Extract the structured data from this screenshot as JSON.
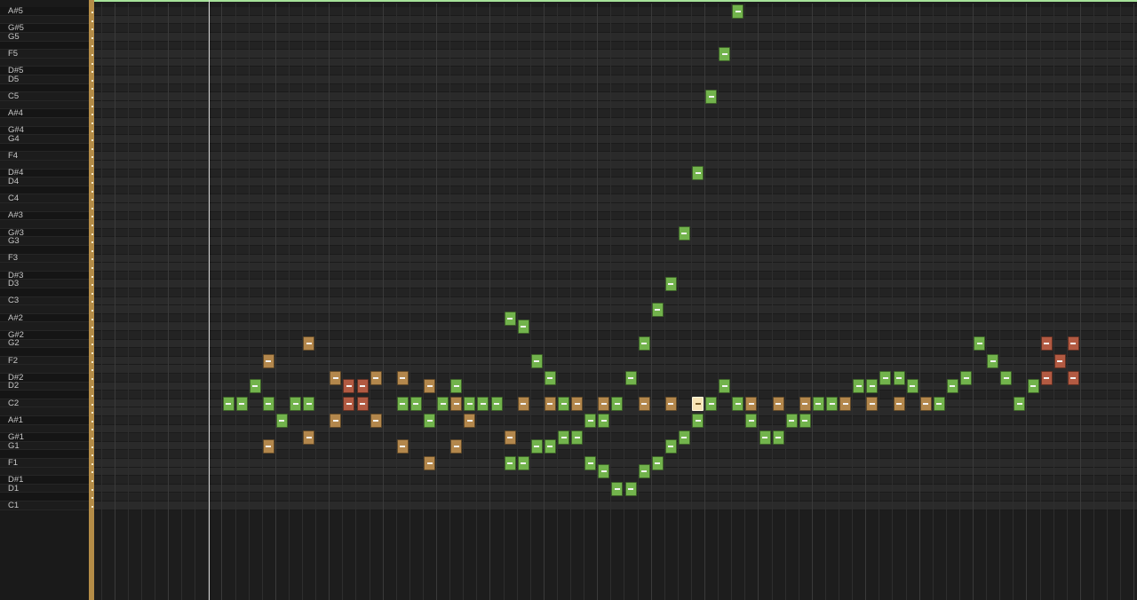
{
  "editor": "piano-roll",
  "colors": {
    "background": "#1d1d1d",
    "white_lane": "#2a2a2a",
    "black_lane": "#232323",
    "note_green": "#72b34c",
    "note_orange": "#b3874c",
    "note_red": "#b25a42",
    "note_selected": "#f7e4b5",
    "loop_strip": "#b48c47",
    "top_marker": "#a6e39a",
    "playhead": "#d8d8d8"
  },
  "keyboard": {
    "pitches": [
      "A#5",
      "A5",
      "G#5",
      "G5",
      "F#5",
      "F5",
      "E5",
      "D#5",
      "D5",
      "C#5",
      "C5",
      "B4",
      "A#4",
      "A4",
      "G#4",
      "G4",
      "F#4",
      "F4",
      "E4",
      "D#4",
      "D4",
      "C#4",
      "C4",
      "B3",
      "A#3",
      "A3",
      "G#3",
      "G3",
      "F#3",
      "F3",
      "E3",
      "D#3",
      "D3",
      "C#3",
      "C3",
      "B2",
      "A#2",
      "A2",
      "G#2",
      "G2",
      "F#2",
      "F2",
      "E2",
      "D#2",
      "D2",
      "C#2",
      "C2",
      "B1",
      "A#1",
      "A1",
      "G#1",
      "G1",
      "F#1",
      "F1",
      "E1",
      "D#1",
      "D1",
      "C#1",
      "C1"
    ],
    "labels": [
      {
        "pitch": "A#5",
        "text": "A#5"
      },
      {
        "pitch": "G#5",
        "text": "G#5"
      },
      {
        "pitch": "G5",
        "text": "G5"
      },
      {
        "pitch": "F5",
        "text": "F5"
      },
      {
        "pitch": "D#5",
        "text": "D#5"
      },
      {
        "pitch": "D5",
        "text": "D5"
      },
      {
        "pitch": "C5",
        "text": "C5"
      },
      {
        "pitch": "A#4",
        "text": "A#4"
      },
      {
        "pitch": "G#4",
        "text": "G#4"
      },
      {
        "pitch": "G4",
        "text": "G4"
      },
      {
        "pitch": "F4",
        "text": "F4"
      },
      {
        "pitch": "D#4",
        "text": "D#4"
      },
      {
        "pitch": "D4",
        "text": "D4"
      },
      {
        "pitch": "C4",
        "text": "C4"
      },
      {
        "pitch": "A#3",
        "text": "A#3"
      },
      {
        "pitch": "G#3",
        "text": "G#3"
      },
      {
        "pitch": "G3",
        "text": "G3"
      },
      {
        "pitch": "F3",
        "text": "F3"
      },
      {
        "pitch": "D#3",
        "text": "D#3"
      },
      {
        "pitch": "D3",
        "text": "D3"
      },
      {
        "pitch": "C3",
        "text": "C3"
      },
      {
        "pitch": "A#2",
        "text": "A#2"
      },
      {
        "pitch": "G#2",
        "text": "G#2"
      },
      {
        "pitch": "G2",
        "text": "G2"
      },
      {
        "pitch": "F2",
        "text": "F2"
      },
      {
        "pitch": "D#2",
        "text": "D#2"
      },
      {
        "pitch": "D2",
        "text": "D2"
      },
      {
        "pitch": "C2",
        "text": "C2"
      },
      {
        "pitch": "A#1",
        "text": "A#1"
      },
      {
        "pitch": "G#1",
        "text": "G#1"
      },
      {
        "pitch": "G1",
        "text": "G1"
      },
      {
        "pitch": "F1",
        "text": "F1"
      },
      {
        "pitch": "D#1",
        "text": "D#1"
      },
      {
        "pitch": "D1",
        "text": "D1"
      },
      {
        "pitch": "C1",
        "text": "C1"
      }
    ]
  },
  "notes": [
    {
      "step": 0,
      "pitch": "C2",
      "color": "green"
    },
    {
      "step": 1,
      "pitch": "C2",
      "color": "green"
    },
    {
      "step": 2,
      "pitch": "D2",
      "color": "green"
    },
    {
      "step": 3,
      "pitch": "F2",
      "color": "orange"
    },
    {
      "step": 3,
      "pitch": "C2",
      "color": "green"
    },
    {
      "step": 3,
      "pitch": "G1",
      "color": "orange"
    },
    {
      "step": 4,
      "pitch": "A#1",
      "color": "green"
    },
    {
      "step": 5,
      "pitch": "C2",
      "color": "green"
    },
    {
      "step": 6,
      "pitch": "G2",
      "color": "orange"
    },
    {
      "step": 6,
      "pitch": "C2",
      "color": "green"
    },
    {
      "step": 6,
      "pitch": "G#1",
      "color": "orange"
    },
    {
      "step": 8,
      "pitch": "D#2",
      "color": "orange"
    },
    {
      "step": 8,
      "pitch": "A#1",
      "color": "orange"
    },
    {
      "step": 9,
      "pitch": "D2",
      "color": "red"
    },
    {
      "step": 9,
      "pitch": "C2",
      "color": "red"
    },
    {
      "step": 10,
      "pitch": "D2",
      "color": "red"
    },
    {
      "step": 10,
      "pitch": "C2",
      "color": "red"
    },
    {
      "step": 11,
      "pitch": "D#2",
      "color": "orange"
    },
    {
      "step": 11,
      "pitch": "A#1",
      "color": "orange"
    },
    {
      "step": 13,
      "pitch": "D#2",
      "color": "orange"
    },
    {
      "step": 13,
      "pitch": "C2",
      "color": "green"
    },
    {
      "step": 13,
      "pitch": "G1",
      "color": "orange"
    },
    {
      "step": 14,
      "pitch": "C2",
      "color": "green"
    },
    {
      "step": 15,
      "pitch": "D2",
      "color": "orange"
    },
    {
      "step": 15,
      "pitch": "A#1",
      "color": "green"
    },
    {
      "step": 15,
      "pitch": "F1",
      "color": "orange"
    },
    {
      "step": 16,
      "pitch": "C2",
      "color": "green"
    },
    {
      "step": 17,
      "pitch": "D2",
      "color": "green"
    },
    {
      "step": 17,
      "pitch": "C2",
      "color": "orange"
    },
    {
      "step": 17,
      "pitch": "G1",
      "color": "orange"
    },
    {
      "step": 18,
      "pitch": "C2",
      "color": "green"
    },
    {
      "step": 18,
      "pitch": "A#1",
      "color": "orange"
    },
    {
      "step": 19,
      "pitch": "C2",
      "color": "green"
    },
    {
      "step": 20,
      "pitch": "C2",
      "color": "green"
    },
    {
      "step": 21,
      "pitch": "A#2",
      "color": "green"
    },
    {
      "step": 21,
      "pitch": "G#1",
      "color": "orange"
    },
    {
      "step": 21,
      "pitch": "F1",
      "color": "green"
    },
    {
      "step": 22,
      "pitch": "A2",
      "color": "green"
    },
    {
      "step": 22,
      "pitch": "C2",
      "color": "orange"
    },
    {
      "step": 22,
      "pitch": "F1",
      "color": "green"
    },
    {
      "step": 23,
      "pitch": "F2",
      "color": "green"
    },
    {
      "step": 23,
      "pitch": "G1",
      "color": "green"
    },
    {
      "step": 24,
      "pitch": "D#2",
      "color": "green"
    },
    {
      "step": 24,
      "pitch": "C2",
      "color": "orange"
    },
    {
      "step": 24,
      "pitch": "G1",
      "color": "green"
    },
    {
      "step": 25,
      "pitch": "C2",
      "color": "green"
    },
    {
      "step": 25,
      "pitch": "G#1",
      "color": "green"
    },
    {
      "step": 26,
      "pitch": "C2",
      "color": "orange"
    },
    {
      "step": 26,
      "pitch": "G#1",
      "color": "green"
    },
    {
      "step": 27,
      "pitch": "A#1",
      "color": "green"
    },
    {
      "step": 27,
      "pitch": "F1",
      "color": "green"
    },
    {
      "step": 28,
      "pitch": "C2",
      "color": "orange"
    },
    {
      "step": 28,
      "pitch": "A#1",
      "color": "green"
    },
    {
      "step": 28,
      "pitch": "E1",
      "color": "green"
    },
    {
      "step": 29,
      "pitch": "C2",
      "color": "green"
    },
    {
      "step": 29,
      "pitch": "D1",
      "color": "green"
    },
    {
      "step": 30,
      "pitch": "D#2",
      "color": "green"
    },
    {
      "step": 30,
      "pitch": "D1",
      "color": "green"
    },
    {
      "step": 31,
      "pitch": "G2",
      "color": "green"
    },
    {
      "step": 31,
      "pitch": "C2",
      "color": "orange"
    },
    {
      "step": 31,
      "pitch": "E1",
      "color": "green"
    },
    {
      "step": 32,
      "pitch": "B2",
      "color": "green"
    },
    {
      "step": 32,
      "pitch": "F1",
      "color": "green"
    },
    {
      "step": 33,
      "pitch": "D3",
      "color": "green"
    },
    {
      "step": 33,
      "pitch": "C2",
      "color": "orange"
    },
    {
      "step": 33,
      "pitch": "G1",
      "color": "green"
    },
    {
      "step": 34,
      "pitch": "G#3",
      "color": "green"
    },
    {
      "step": 34,
      "pitch": "G#1",
      "color": "green"
    },
    {
      "step": 35,
      "pitch": "D#4",
      "color": "green"
    },
    {
      "step": 35,
      "pitch": "C2",
      "color": "selected"
    },
    {
      "step": 35,
      "pitch": "A#1",
      "color": "green"
    },
    {
      "step": 36,
      "pitch": "C5",
      "color": "green"
    },
    {
      "step": 36,
      "pitch": "C2",
      "color": "green"
    },
    {
      "step": 37,
      "pitch": "F5",
      "color": "green"
    },
    {
      "step": 37,
      "pitch": "D2",
      "color": "green"
    },
    {
      "step": 38,
      "pitch": "A#5",
      "color": "green"
    },
    {
      "step": 38,
      "pitch": "C2",
      "color": "green"
    },
    {
      "step": 39,
      "pitch": "C2",
      "color": "orange"
    },
    {
      "step": 39,
      "pitch": "A#1",
      "color": "green"
    },
    {
      "step": 40,
      "pitch": "G#1",
      "color": "green"
    },
    {
      "step": 41,
      "pitch": "C2",
      "color": "orange"
    },
    {
      "step": 41,
      "pitch": "G#1",
      "color": "green"
    },
    {
      "step": 42,
      "pitch": "A#1",
      "color": "green"
    },
    {
      "step": 43,
      "pitch": "C2",
      "color": "orange"
    },
    {
      "step": 43,
      "pitch": "A#1",
      "color": "green"
    },
    {
      "step": 44,
      "pitch": "C2",
      "color": "green"
    },
    {
      "step": 45,
      "pitch": "C2",
      "color": "green"
    },
    {
      "step": 46,
      "pitch": "C2",
      "color": "orange"
    },
    {
      "step": 47,
      "pitch": "D2",
      "color": "green"
    },
    {
      "step": 48,
      "pitch": "D2",
      "color": "green"
    },
    {
      "step": 48,
      "pitch": "C2",
      "color": "orange"
    },
    {
      "step": 49,
      "pitch": "D#2",
      "color": "green"
    },
    {
      "step": 50,
      "pitch": "D#2",
      "color": "green"
    },
    {
      "step": 50,
      "pitch": "C2",
      "color": "orange"
    },
    {
      "step": 51,
      "pitch": "D2",
      "color": "green"
    },
    {
      "step": 52,
      "pitch": "C2",
      "color": "orange"
    },
    {
      "step": 53,
      "pitch": "C2",
      "color": "green"
    },
    {
      "step": 54,
      "pitch": "D2",
      "color": "green"
    },
    {
      "step": 55,
      "pitch": "D#2",
      "color": "green"
    },
    {
      "step": 56,
      "pitch": "G2",
      "color": "green"
    },
    {
      "step": 57,
      "pitch": "F2",
      "color": "green"
    },
    {
      "step": 58,
      "pitch": "D#2",
      "color": "green"
    },
    {
      "step": 59,
      "pitch": "C2",
      "color": "green"
    },
    {
      "step": 60,
      "pitch": "D2",
      "color": "green"
    },
    {
      "step": 61,
      "pitch": "G2",
      "color": "red"
    },
    {
      "step": 61,
      "pitch": "D#2",
      "color": "red"
    },
    {
      "step": 62,
      "pitch": "F2",
      "color": "red"
    },
    {
      "step": 63,
      "pitch": "G2",
      "color": "red"
    },
    {
      "step": 63,
      "pitch": "D#2",
      "color": "red"
    }
  ]
}
